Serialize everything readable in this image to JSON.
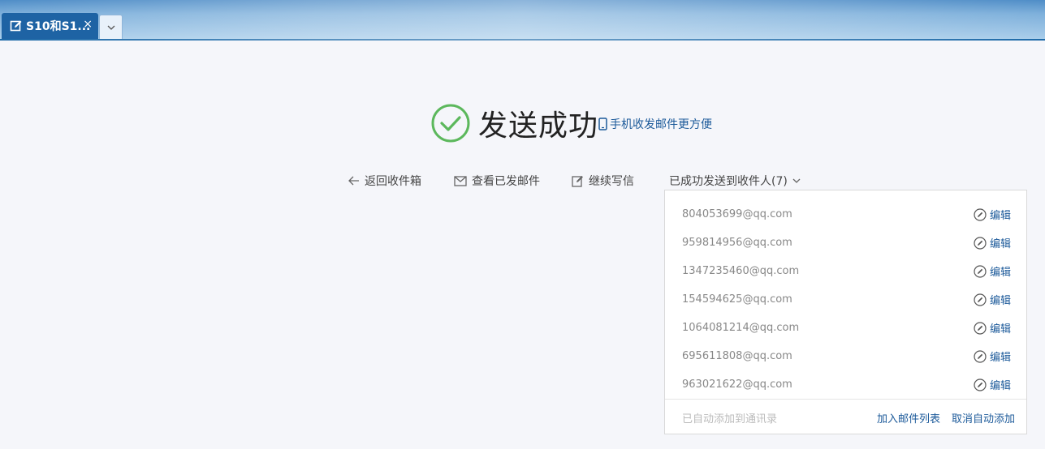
{
  "tabs": {
    "active_title": "S10和S1...",
    "close": "×"
  },
  "success": {
    "title": "发送成功",
    "mobile_link": "手机收发邮件更方便"
  },
  "actions": {
    "back_inbox": "返回收件箱",
    "view_sent": "查看已发邮件",
    "continue_write": "继续写信",
    "sent_to": "已成功发送到收件人(7)"
  },
  "recipients": {
    "edit_label": "编辑",
    "items": [
      "804053699@qq.com",
      "959814956@qq.com",
      "1347235460@qq.com",
      "154594625@qq.com",
      "1064081214@qq.com",
      "695611808@qq.com",
      "963021622@qq.com"
    ],
    "footer_note": "已自动添加到通讯录",
    "add_to_list": "加入邮件列表",
    "cancel_auto_add": "取消自动添加"
  },
  "colors": {
    "accent": "#1c5a9a",
    "success_green": "#5cb85c",
    "tab_bg": "#1e63a4"
  }
}
